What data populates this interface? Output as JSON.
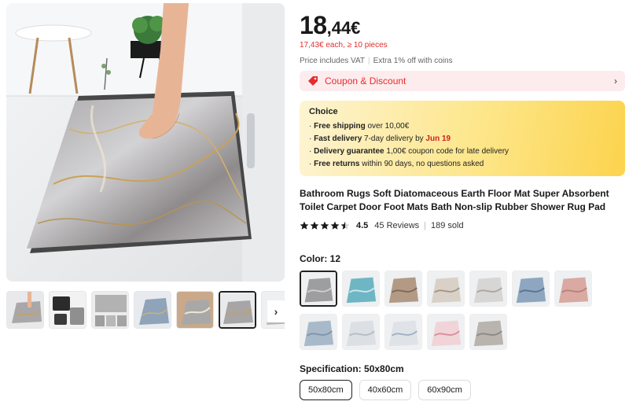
{
  "gallery": {
    "thumbnail_count": 7,
    "active_thumbnail": 5,
    "next_icon": "chevron-right-icon"
  },
  "price": {
    "integer": "18",
    "decimal": ",44€",
    "bulk_text": "17,43€ each, ≥ 10 pieces",
    "vat_text": "Price includes VAT",
    "coins_text": "Extra 1% off with coins"
  },
  "coupon": {
    "label": "Coupon & Discount",
    "icon": "tag-icon"
  },
  "choice": {
    "title": "Choice",
    "rows": [
      {
        "bold": "Free shipping",
        "text": " over 10,00€",
        "highlight": ""
      },
      {
        "bold": "Fast delivery",
        "text": " 7-day delivery by ",
        "highlight": "Jun 19"
      },
      {
        "bold": "Delivery guarantee",
        "text": "  1,00€ coupon code for late delivery",
        "highlight": ""
      },
      {
        "bold": "Free returns",
        "text": "  within 90 days, no questions asked",
        "highlight": ""
      }
    ]
  },
  "product": {
    "title": "Bathroom Rugs Soft Diatomaceous Earth Floor Mat Super Absorbent Toilet Carpet Door Foot Mats Bath Non-slip Rubber Shower Rug Pad",
    "rating": "4.5",
    "rating_fraction": 0.9,
    "reviews": "45 Reviews",
    "divider": "|",
    "sold": "189 sold"
  },
  "color": {
    "label": "Color: 12",
    "active_index": 0,
    "swatches": [
      {
        "base": "#9e9ea0",
        "accent": "#cfcfd2"
      },
      {
        "base": "#6fb6c4",
        "accent": "#cfe6ea"
      },
      {
        "base": "#b39a84",
        "accent": "#7d6a5a"
      },
      {
        "base": "#d9d1c7",
        "accent": "#a39587"
      },
      {
        "base": "#d8d6d4",
        "accent": "#a9a6a3"
      },
      {
        "base": "#8ea6bf",
        "accent": "#5a7390"
      },
      {
        "base": "#d9a9a2",
        "accent": "#b8827a"
      },
      {
        "base": "#a8b9c9",
        "accent": "#7f94aa"
      },
      {
        "base": "#dcdfe3",
        "accent": "#b5bcc5"
      },
      {
        "base": "#dfe3e8",
        "accent": "#9fb0c4"
      },
      {
        "base": "#f0d4d8",
        "accent": "#d98d9a"
      },
      {
        "base": "#b9b4ad",
        "accent": "#8d8882"
      }
    ]
  },
  "specification": {
    "label": "Specification: 50x80cm",
    "options": [
      "50x80cm",
      "40x60cm",
      "60x90cm"
    ],
    "active_index": 0
  },
  "colors": {
    "accent_red": "#e52d2d",
    "coupon_bg": "#fdecee",
    "choice_gold": "#fcd34d"
  }
}
